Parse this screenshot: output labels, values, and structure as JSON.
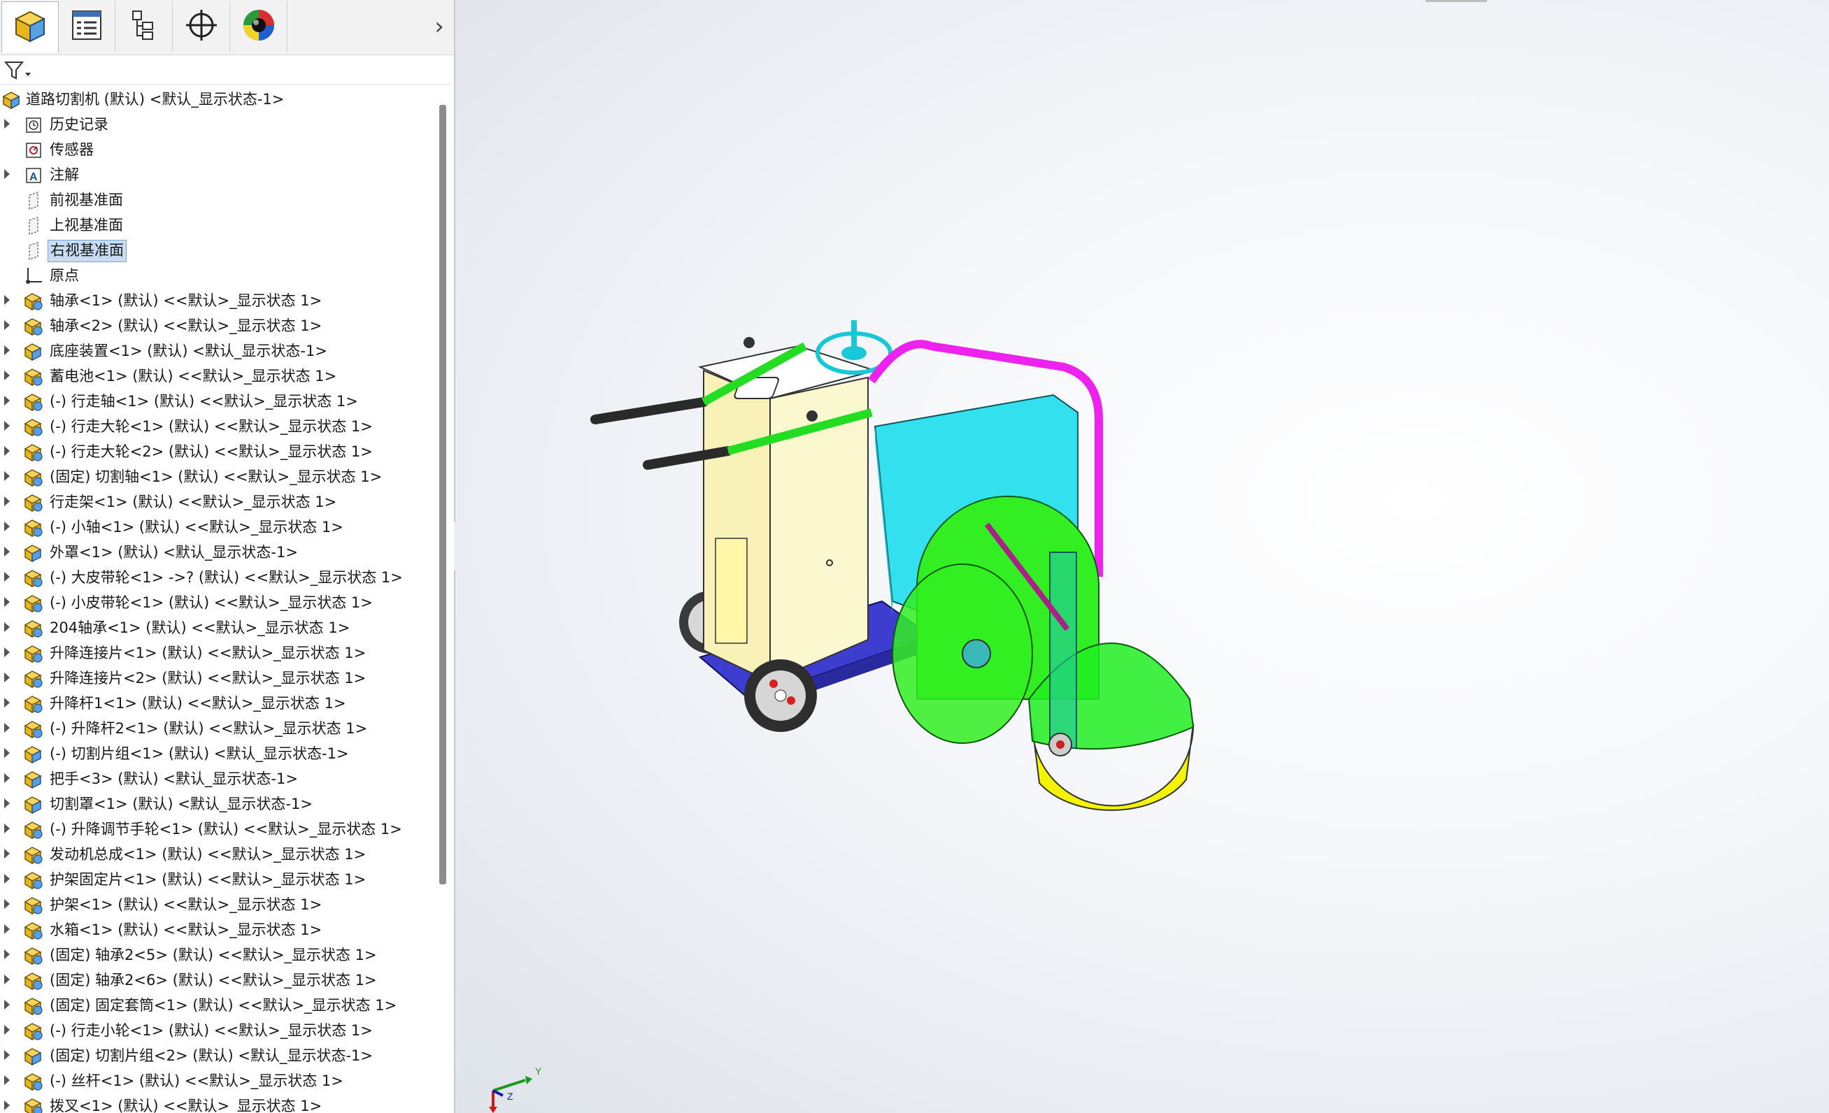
{
  "panel_tabs": [
    {
      "name": "featuremanager-tab",
      "icon": "assembly-cube-icon"
    },
    {
      "name": "propertymanager-tab",
      "icon": "property-list-icon"
    },
    {
      "name": "configurationmanager-tab",
      "icon": "configuration-tree-icon"
    },
    {
      "name": "dimxpert-tab",
      "icon": "crosshair-icon"
    },
    {
      "name": "display-manager-tab",
      "icon": "appearance-sphere-icon"
    }
  ],
  "tree": {
    "root": "道路切割机 (默认) <默认_显示状态-1>",
    "items": [
      {
        "label": "历史记录",
        "icon": "history-icon",
        "expandable": true
      },
      {
        "label": "传感器",
        "icon": "sensor-icon",
        "expandable": false
      },
      {
        "label": "注解",
        "icon": "annotation-icon",
        "expandable": true
      },
      {
        "label": "前视基准面",
        "icon": "plane-icon",
        "expandable": false
      },
      {
        "label": "上视基准面",
        "icon": "plane-icon",
        "expandable": false
      },
      {
        "label": "右视基准面",
        "icon": "plane-icon",
        "expandable": false,
        "selected": true
      },
      {
        "label": "原点",
        "icon": "origin-icon",
        "expandable": false
      },
      {
        "label": "轴承<1> (默认) <<默认>_显示状态 1>",
        "icon": "part-icon",
        "expandable": true
      },
      {
        "label": "轴承<2> (默认) <<默认>_显示状态 1>",
        "icon": "part-icon",
        "expandable": true
      },
      {
        "label": "底座装置<1> (默认) <默认_显示状态-1>",
        "icon": "subassembly-icon",
        "expandable": true
      },
      {
        "label": "蓄电池<1> (默认) <<默认>_显示状态 1>",
        "icon": "part-icon",
        "expandable": true
      },
      {
        "label": "(-) 行走轴<1> (默认) <<默认>_显示状态 1>",
        "icon": "part-icon",
        "expandable": true
      },
      {
        "label": "(-) 行走大轮<1> (默认) <<默认>_显示状态 1>",
        "icon": "part-icon",
        "expandable": true
      },
      {
        "label": "(-) 行走大轮<2> (默认) <<默认>_显示状态 1>",
        "icon": "part-icon",
        "expandable": true
      },
      {
        "label": "(固定) 切割轴<1> (默认) <<默认>_显示状态 1>",
        "icon": "part-icon",
        "expandable": true
      },
      {
        "label": "行走架<1> (默认) <<默认>_显示状态 1>",
        "icon": "part-icon",
        "expandable": true
      },
      {
        "label": "(-) 小轴<1> (默认) <<默认>_显示状态 1>",
        "icon": "part-icon",
        "expandable": true
      },
      {
        "label": "外罩<1> (默认) <默认_显示状态-1>",
        "icon": "subassembly-icon",
        "expandable": true
      },
      {
        "label": "(-) 大皮带轮<1> ->? (默认) <<默认>_显示状态 1>",
        "icon": "part-icon",
        "expandable": true
      },
      {
        "label": "(-) 小皮带轮<1> (默认) <<默认>_显示状态 1>",
        "icon": "part-icon",
        "expandable": true
      },
      {
        "label": "204轴承<1> (默认) <<默认>_显示状态 1>",
        "icon": "part-icon",
        "expandable": true
      },
      {
        "label": "升降连接片<1> (默认) <<默认>_显示状态 1>",
        "icon": "part-icon",
        "expandable": true
      },
      {
        "label": "升降连接片<2> (默认) <<默认>_显示状态 1>",
        "icon": "part-icon",
        "expandable": true
      },
      {
        "label": "升降杆1<1> (默认) <<默认>_显示状态 1>",
        "icon": "part-icon",
        "expandable": true
      },
      {
        "label": "(-) 升降杆2<1> (默认) <<默认>_显示状态 1>",
        "icon": "part-icon",
        "expandable": true
      },
      {
        "label": "(-) 切割片组<1> (默认) <默认_显示状态-1>",
        "icon": "subassembly-icon",
        "expandable": true
      },
      {
        "label": "把手<3> (默认) <默认_显示状态-1>",
        "icon": "subassembly-icon",
        "expandable": true
      },
      {
        "label": "切割罩<1> (默认) <默认_显示状态-1>",
        "icon": "subassembly-icon",
        "expandable": true
      },
      {
        "label": "(-) 升降调节手轮<1> (默认) <<默认>_显示状态 1>",
        "icon": "part-icon",
        "expandable": true
      },
      {
        "label": "发动机总成<1> (默认) <<默认>_显示状态 1>",
        "icon": "part-icon",
        "expandable": true
      },
      {
        "label": "护架固定片<1> (默认) <<默认>_显示状态 1>",
        "icon": "part-icon",
        "expandable": true
      },
      {
        "label": "护架<1> (默认) <<默认>_显示状态 1>",
        "icon": "part-icon",
        "expandable": true
      },
      {
        "label": "水箱<1> (默认) <<默认>_显示状态 1>",
        "icon": "part-icon",
        "expandable": true
      },
      {
        "label": "(固定) 轴承2<5> (默认) <<默认>_显示状态 1>",
        "icon": "part-icon",
        "expandable": true
      },
      {
        "label": "(固定) 轴承2<6> (默认) <<默认>_显示状态 1>",
        "icon": "part-icon",
        "expandable": true
      },
      {
        "label": "(固定) 固定套筒<1> (默认) <<默认>_显示状态 1>",
        "icon": "part-icon",
        "expandable": true
      },
      {
        "label": "(-) 行走小轮<1> (默认) <<默认>_显示状态 1>",
        "icon": "part-icon",
        "expandable": true
      },
      {
        "label": "(固定) 切割片组<2> (默认) <默认_显示状态-1>",
        "icon": "subassembly-icon",
        "expandable": true
      },
      {
        "label": "(-) 丝杆<1> (默认) <<默认>_显示状态 1>",
        "icon": "part-icon",
        "expandable": true
      },
      {
        "label": "拨叉<1> (默认) <<默认>_显示状态 1>",
        "icon": "part-icon",
        "expandable": true
      }
    ]
  },
  "triad": {
    "x": "",
    "y": "Y",
    "z": "Z"
  },
  "colors": {
    "selection": "#c8dcf4",
    "handle_green": "#22dd22",
    "frame_yellow": "#fbf8d0",
    "engine_cyan": "#33e0ee",
    "guard_magenta": "#ee22ee",
    "base_blue": "#3030c8",
    "blade_yellow": "#f4f400",
    "cover_green": "#22ee22"
  }
}
